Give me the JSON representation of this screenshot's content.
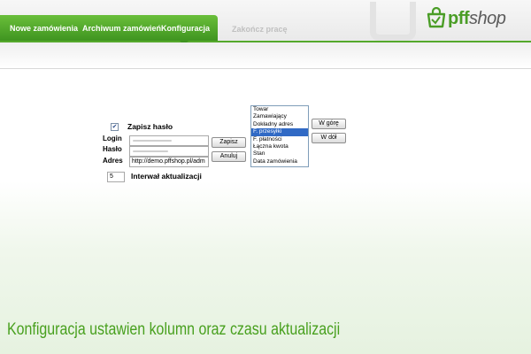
{
  "header": {
    "tabs": [
      {
        "label": "Nowe zamówienia"
      },
      {
        "label": "Archiwum zamówień"
      },
      {
        "label": "Konfiguracja"
      }
    ],
    "finish_label": "Zakończ pracę",
    "logo": {
      "brand": "pff",
      "suffix": "shop"
    }
  },
  "form": {
    "save_password_label": "Zapisz hasło",
    "save_password_checked": true,
    "login_label": "Login",
    "password_label": "Hasło",
    "address_label": "Adres",
    "address_value": "http://demo.pffshop.pl/adm",
    "save_button": "Zapisz",
    "cancel_button": "Anuluj",
    "interval_value": "5",
    "interval_label": "Interwał aktualizacji"
  },
  "columns": {
    "items": [
      "Towar",
      "Zamawiający",
      "Dokładny adres",
      "F. przesyłki",
      "F. płatności",
      "Łączna kwota",
      "Stan",
      "Data zamówienia"
    ],
    "selected_index": 3,
    "up_button": "W górę",
    "down_button": "W dół"
  },
  "caption": "Konfiguracja ustawien kolumn oraz czasu aktualizacji",
  "colors": {
    "accent": "#4a9d26",
    "selection": "#316ac5"
  }
}
